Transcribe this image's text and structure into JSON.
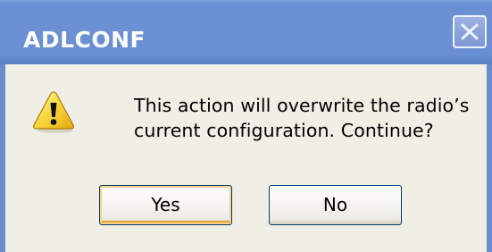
{
  "window": {
    "title": "ADLCONF"
  },
  "dialog": {
    "message_line1": "This action will overwrite the radio’s",
    "message_line2": "current configuration. Continue?",
    "icon": "warning-icon"
  },
  "buttons": {
    "yes_label": "Yes",
    "no_label": "No"
  },
  "colors": {
    "titlebar": "#6b90d4",
    "body": "#f0efe6",
    "title_text": "#ffffff",
    "default_button_focus": "#f7cf86"
  }
}
